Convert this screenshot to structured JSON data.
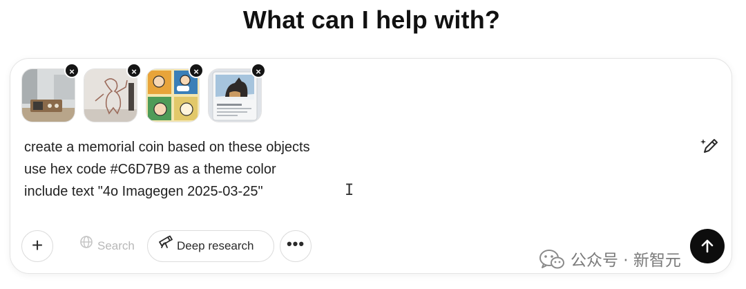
{
  "heading": "What can I help with?",
  "attachments": [
    {
      "name": "attachment-image-1",
      "remove": "×"
    },
    {
      "name": "attachment-image-2",
      "remove": "×"
    },
    {
      "name": "attachment-image-3",
      "remove": "×"
    },
    {
      "name": "attachment-image-4",
      "remove": "×"
    }
  ],
  "prompt": {
    "lines": [
      "create a memorial coin based on these objects",
      "use hex code #C6D7B9 as a theme color",
      "include text \"4o Imagegen 2025-03-25\""
    ],
    "cursor": "I"
  },
  "toolbar": {
    "plus_label": "+",
    "search_label": "Search",
    "deep_research_label": "Deep research",
    "more_label": "•••"
  },
  "icons": {
    "edit": "pencil-sparkle-icon",
    "globe": "globe-icon",
    "telescope": "telescope-icon",
    "send": "arrow-up-icon",
    "watermark": "wechat-icon"
  },
  "colors": {
    "send_button": "#0d0d0d",
    "composer_border": "#e4e4e4",
    "search_disabled": "#b8b8b8"
  },
  "watermark": {
    "text": "公众号 · 新智元"
  }
}
